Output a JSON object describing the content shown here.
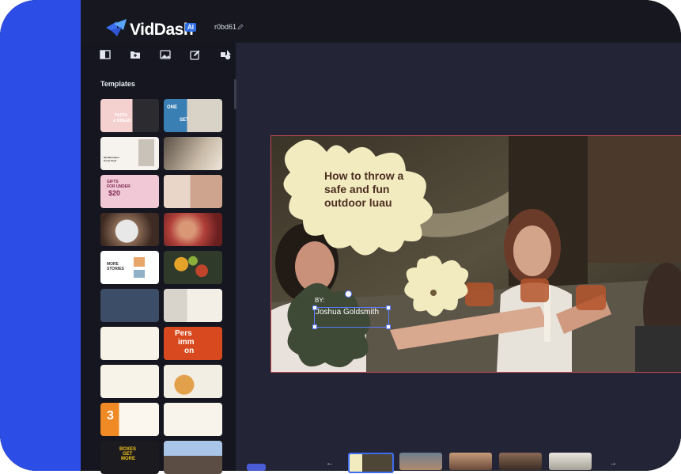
{
  "app": {
    "name": "VidDash",
    "badge": "AI",
    "project_id": "r0bd61"
  },
  "icons": {
    "logo": "viddash-logo-icon",
    "layout": "layout-icon",
    "folder": "folder-add-icon",
    "image": "image-icon",
    "edit": "edit-icon",
    "shapes": "shapes-icon",
    "pencil": "pencil-icon"
  },
  "colors": {
    "accent": "#2d4ee6",
    "selection": "#5b7bff",
    "blob": "#f2ebbf",
    "headline": "#4c2e22",
    "dark_blob": "#3e4a36"
  },
  "sidebar": {
    "section_title": "Templates",
    "templates": [
      {
        "lines": [
          "PASTA",
          "& BREAD"
        ]
      },
      {
        "lines": [
          "ONE",
          "SET"
        ]
      },
      {
        "lines": [
          "My Minimalist",
          "Home Style"
        ]
      },
      {
        "lines": []
      },
      {
        "lines": [
          "GIFTS",
          "FOR UNDER",
          "$20"
        ]
      },
      {
        "lines": []
      },
      {
        "lines": []
      },
      {
        "lines": []
      },
      {
        "lines": [
          "MORE",
          "STORIES"
        ]
      },
      {
        "lines": []
      },
      {
        "lines": []
      },
      {
        "lines": []
      },
      {
        "lines": []
      },
      {
        "lines": [
          "Pers",
          "imm",
          "on"
        ]
      },
      {
        "lines": []
      },
      {
        "lines": []
      },
      {
        "lines": [
          "3"
        ]
      },
      {
        "lines": []
      },
      {
        "lines": [
          "BOXES",
          "GET",
          "MORE"
        ]
      },
      {
        "lines": []
      }
    ]
  },
  "canvas": {
    "headline": "How to throw a safe and fun outdoor luau",
    "byline": "BY:",
    "author": "Joshua Goldsmith"
  },
  "filmstrip": {
    "slides": [
      {
        "active": true
      },
      {
        "active": false
      },
      {
        "active": false
      },
      {
        "active": false
      },
      {
        "active": false
      }
    ]
  }
}
